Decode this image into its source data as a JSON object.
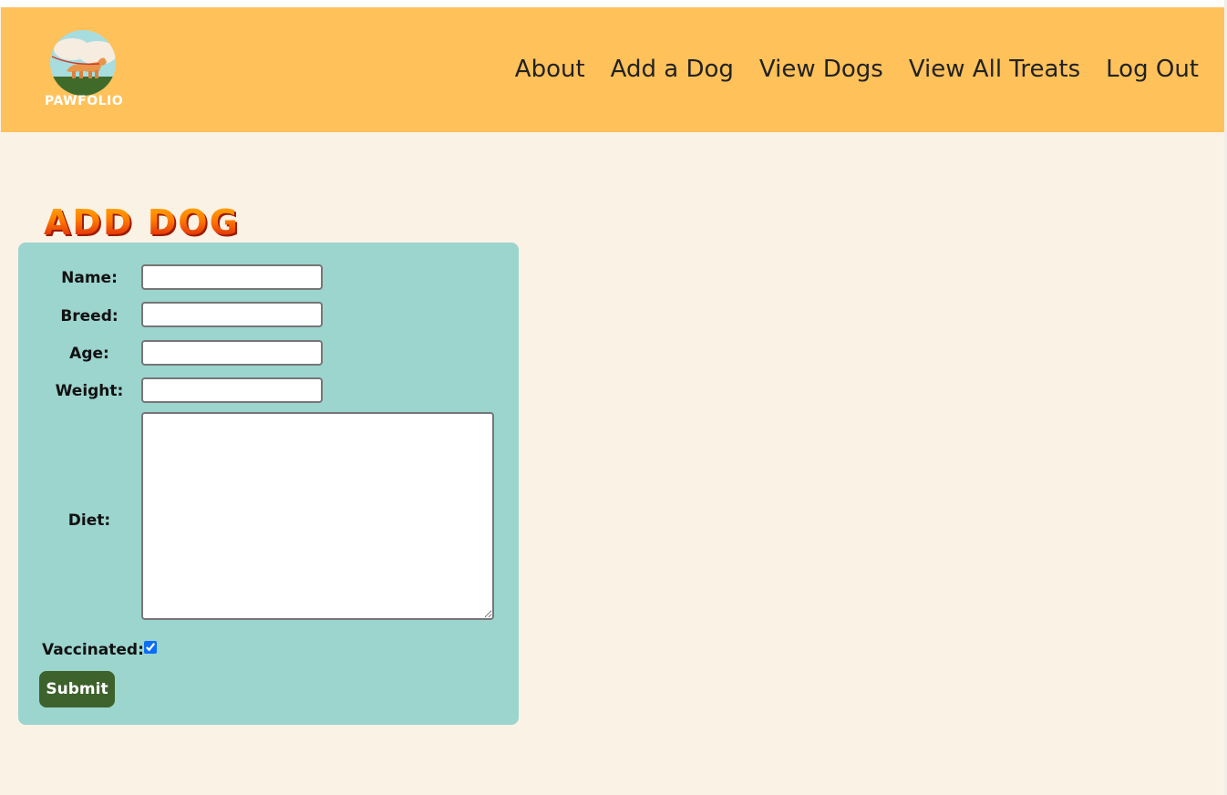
{
  "brand": {
    "name": "PAWFOLIO",
    "logo_icon": "dog-walking-logo-icon"
  },
  "nav": {
    "items": [
      {
        "label": "About"
      },
      {
        "label": "Add a Dog"
      },
      {
        "label": "View Dogs"
      },
      {
        "label": "View All Treats"
      },
      {
        "label": "Log Out"
      }
    ]
  },
  "page": {
    "title": "Add Dog"
  },
  "form": {
    "name": {
      "label": "Name:",
      "value": ""
    },
    "breed": {
      "label": "Breed:",
      "value": ""
    },
    "age": {
      "label": "Age:",
      "value": ""
    },
    "weight": {
      "label": "Weight:",
      "value": ""
    },
    "diet": {
      "label": "Diet:",
      "value": ""
    },
    "vaccinated": {
      "label": "Vaccinated:",
      "checked": true
    },
    "submit_label": "Submit"
  },
  "colors": {
    "navbar_bg": "#ffc15a",
    "page_bg": "#fbf2e6",
    "form_bg": "#9cd4ce",
    "submit_bg": "#3d622b",
    "title_gradient_top": "#ffb300",
    "title_gradient_bottom": "#d40f0f"
  }
}
